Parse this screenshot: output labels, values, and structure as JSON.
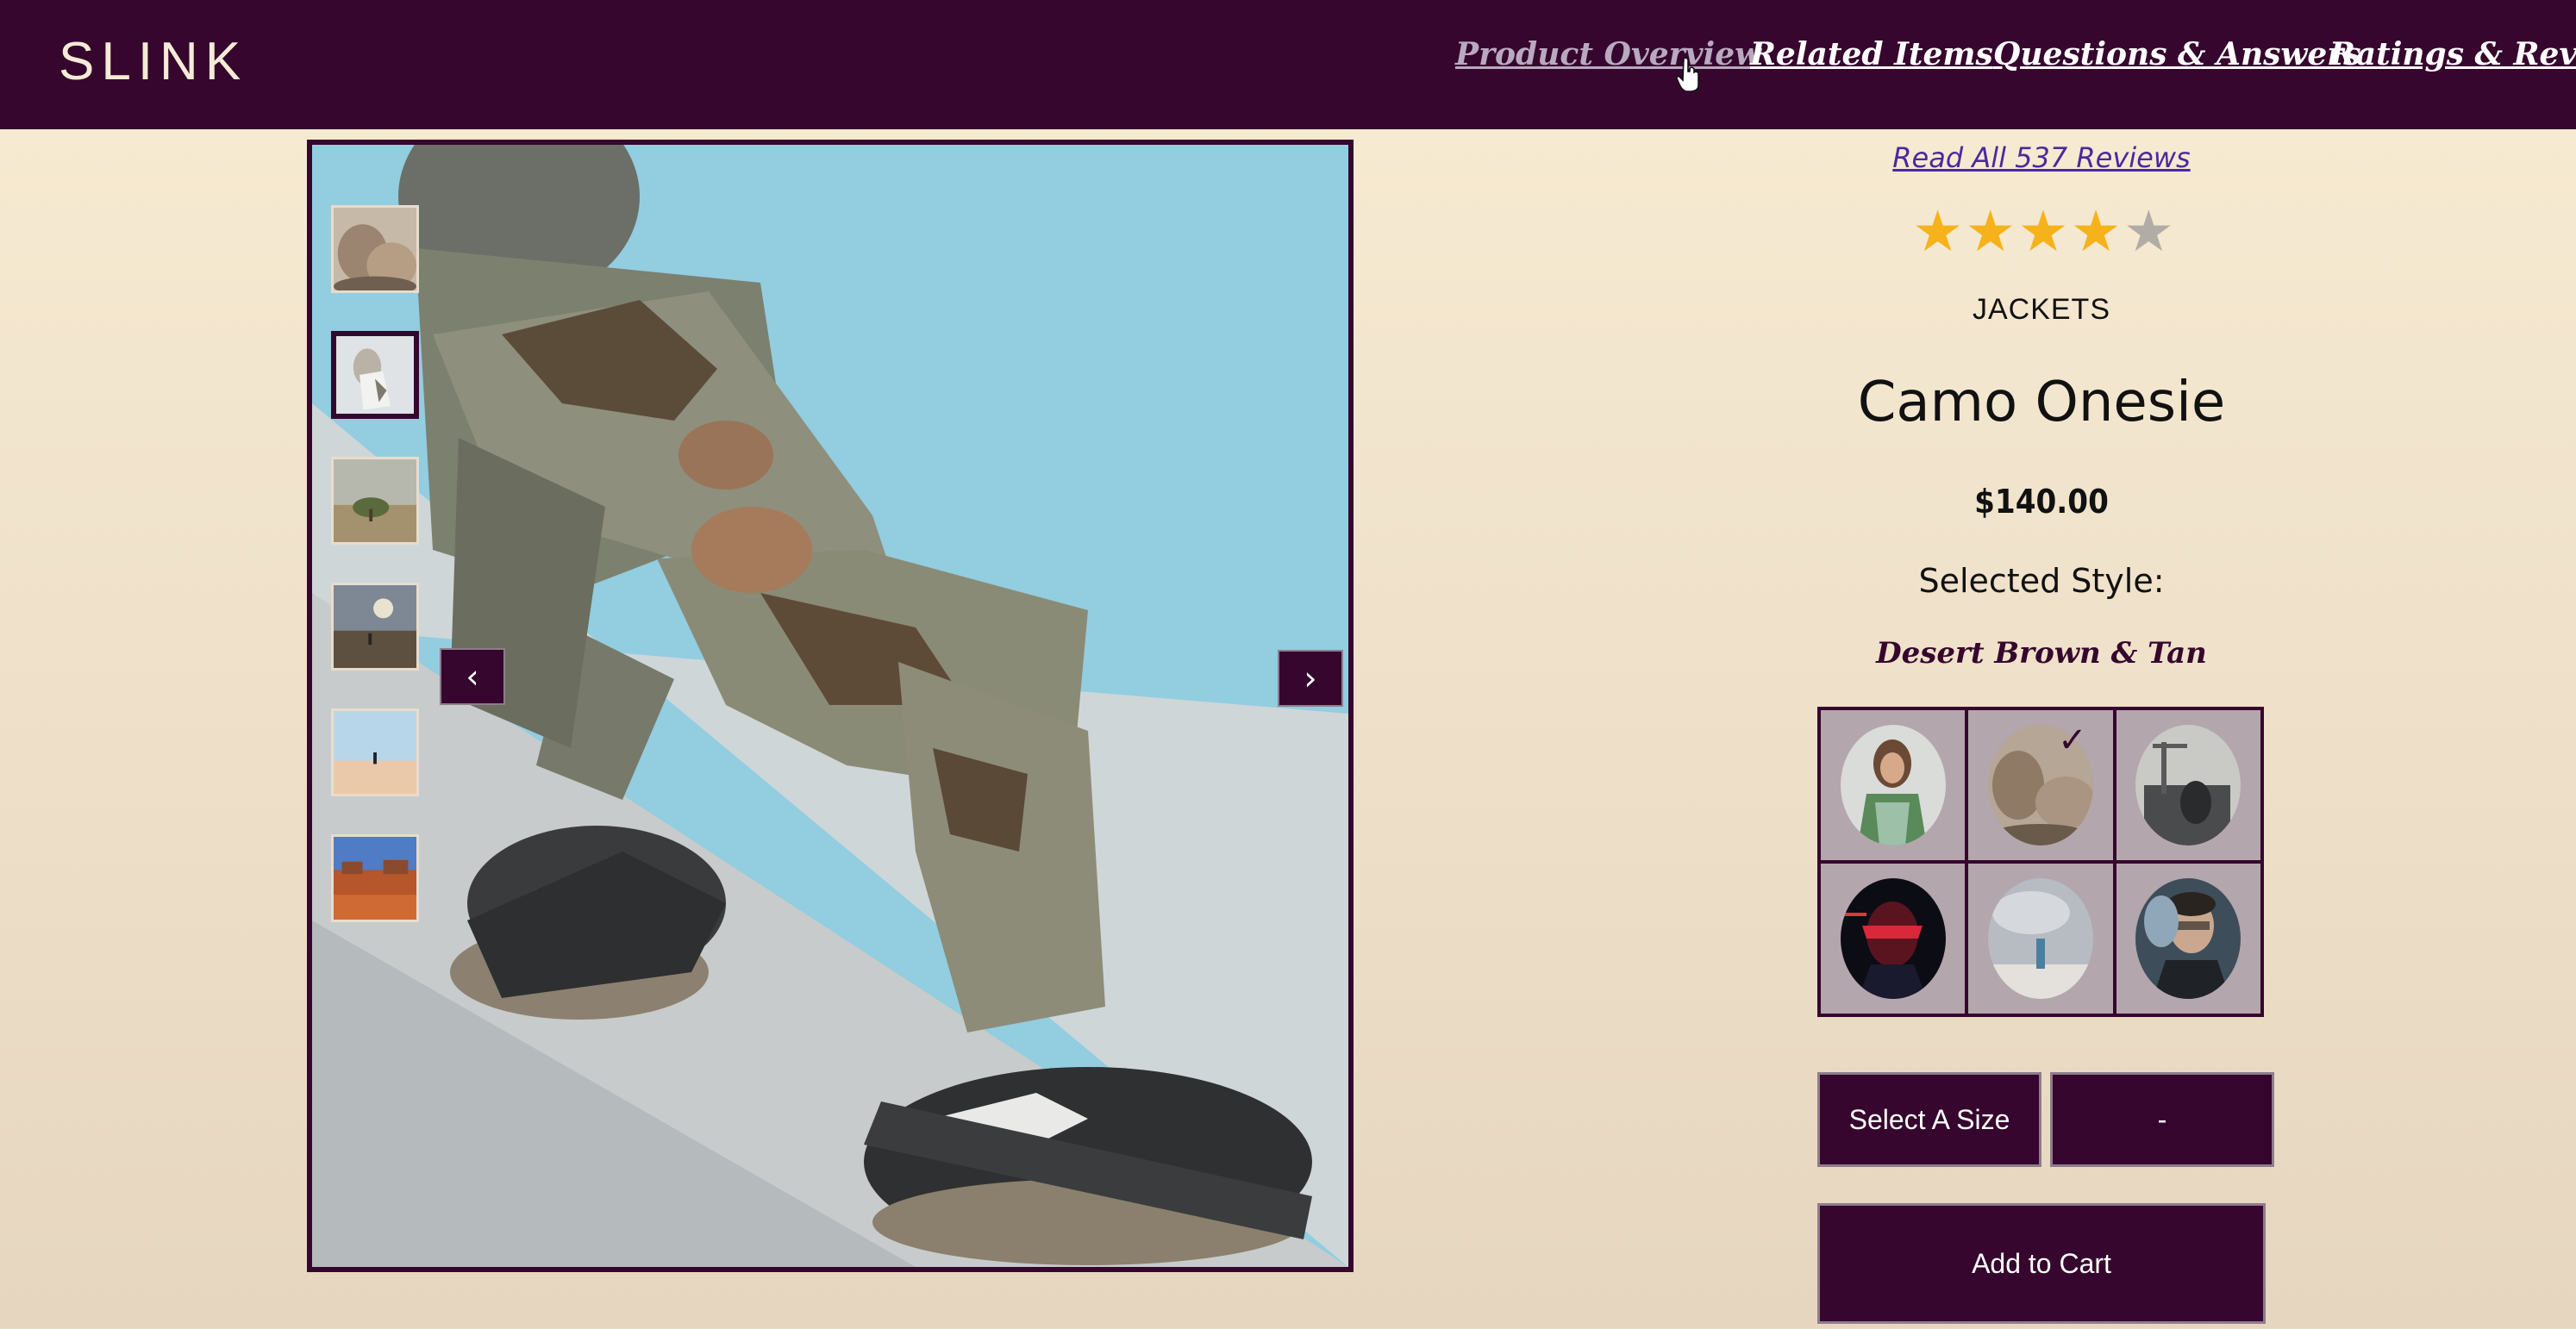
{
  "header": {
    "logo": "SLINK",
    "nav": [
      {
        "label": "Product Overview",
        "active": true
      },
      {
        "label": "Related Items",
        "active": false
      },
      {
        "label": "Questions & Answers",
        "active": false
      },
      {
        "label": "Ratings & Reviews",
        "active": false
      }
    ]
  },
  "gallery": {
    "thumbnail_count": 6,
    "selected_thumbnail": 2,
    "prev_icon": "chevron-left-icon",
    "next_icon": "chevron-right-icon",
    "prev_glyph": "‹",
    "next_glyph": "›"
  },
  "product": {
    "reviews_link": "Read All 537 Reviews",
    "rating": 4,
    "rating_max": 5,
    "category": "JACKETS",
    "name": "Camo Onesie",
    "price": "$140.00",
    "selected_style_label": "Selected Style:",
    "selected_style_name": "Desert Brown & Tan",
    "styles_count": 6,
    "selected_style_index": 2
  },
  "actions": {
    "size_select": "Select A Size",
    "quantity_select": "-",
    "add_to_cart": "Add to Cart"
  },
  "colors": {
    "brand": "#36062e",
    "star_filled": "#f6b21a",
    "star_empty": "#b1aca5",
    "link": "#4a2a9c"
  }
}
